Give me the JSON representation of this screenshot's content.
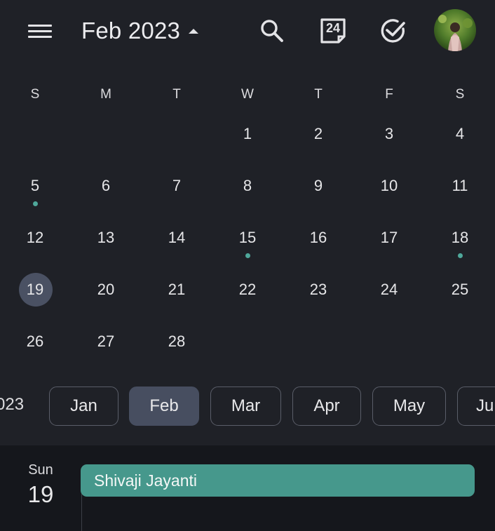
{
  "header": {
    "title": "Feb 2023",
    "today_badge": "24",
    "accent_color": "#46988c"
  },
  "weekdays": [
    "S",
    "M",
    "T",
    "W",
    "T",
    "F",
    "S"
  ],
  "calendar": {
    "weeks": [
      [
        {
          "day": "",
          "dot": false
        },
        {
          "day": "",
          "dot": false
        },
        {
          "day": "",
          "dot": false
        },
        {
          "day": "1",
          "dot": false
        },
        {
          "day": "2",
          "dot": false
        },
        {
          "day": "3",
          "dot": false
        },
        {
          "day": "4",
          "dot": false
        }
      ],
      [
        {
          "day": "5",
          "dot": true
        },
        {
          "day": "6",
          "dot": false
        },
        {
          "day": "7",
          "dot": false
        },
        {
          "day": "8",
          "dot": false
        },
        {
          "day": "9",
          "dot": false
        },
        {
          "day": "10",
          "dot": false
        },
        {
          "day": "11",
          "dot": false
        }
      ],
      [
        {
          "day": "12",
          "dot": false
        },
        {
          "day": "13",
          "dot": false
        },
        {
          "day": "14",
          "dot": false
        },
        {
          "day": "15",
          "dot": true
        },
        {
          "day": "16",
          "dot": false
        },
        {
          "day": "17",
          "dot": false
        },
        {
          "day": "18",
          "dot": true
        }
      ],
      [
        {
          "day": "19",
          "dot": false,
          "selected": true
        },
        {
          "day": "20",
          "dot": false
        },
        {
          "day": "21",
          "dot": false
        },
        {
          "day": "22",
          "dot": false
        },
        {
          "day": "23",
          "dot": false
        },
        {
          "day": "24",
          "dot": false
        },
        {
          "day": "25",
          "dot": false
        }
      ],
      [
        {
          "day": "26",
          "dot": false
        },
        {
          "day": "27",
          "dot": false
        },
        {
          "day": "28",
          "dot": false
        },
        {
          "day": "",
          "dot": false
        },
        {
          "day": "",
          "dot": false
        },
        {
          "day": "",
          "dot": false
        },
        {
          "day": "",
          "dot": false
        }
      ]
    ]
  },
  "month_strip": {
    "year_fragment": "023",
    "months": [
      {
        "label": "Jan",
        "active": false
      },
      {
        "label": "Feb",
        "active": true
      },
      {
        "label": "Mar",
        "active": false
      },
      {
        "label": "Apr",
        "active": false
      },
      {
        "label": "May",
        "active": false
      },
      {
        "label": "Ju",
        "active": false
      }
    ]
  },
  "agenda": {
    "weekday": "Sun",
    "day": "19",
    "events": [
      {
        "title": "Shivaji Jayanti"
      }
    ]
  },
  "icons": {
    "menu": "hamburger-menu-icon",
    "dropdown": "caret-up-icon",
    "search": "search-icon",
    "today": "calendar-today-icon",
    "tasks": "check-circle-icon",
    "account": "avatar"
  }
}
